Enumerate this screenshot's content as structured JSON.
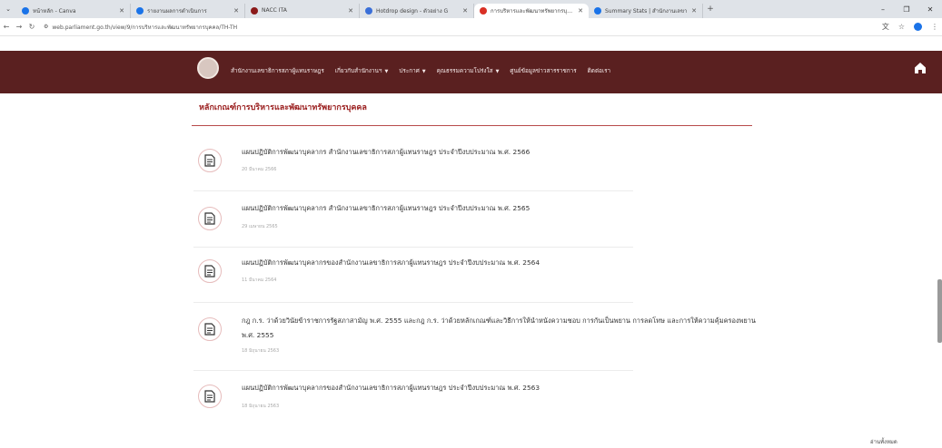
{
  "browser": {
    "tabs": [
      {
        "title": "หน้าหลัก - Canva",
        "favicon_color": "#1a73e8"
      },
      {
        "title": "รายงานผลการดำเนินการ",
        "favicon_color": "#1a73e8"
      },
      {
        "title": "NACC ITA",
        "favicon_color": "#8b1a1a"
      },
      {
        "title": "Hotdrop design - ตัวอย่าง G",
        "favicon_color": "#3a6fd8"
      },
      {
        "title": "การบริหารและพัฒนาทรัพยากรบุคคล",
        "favicon_color": "#d93025"
      },
      {
        "title": "Summary Stats | สำนักงานเลขา",
        "favicon_color": "#1a73e8"
      }
    ],
    "active_tab": 4,
    "url": "web.parliament.go.th/view/9/การบริหารและพัฒนาทรัพยากรบุคคล/TH-TH"
  },
  "site": {
    "nav": [
      {
        "label": "สำนักงานเลขาธิการสภาผู้แทนราษฎร",
        "dropdown": false
      },
      {
        "label": "เกี่ยวกับสำนักงานฯ",
        "dropdown": true
      },
      {
        "label": "ประกาศ",
        "dropdown": true
      },
      {
        "label": "คุณธรรมความโปร่งใส",
        "dropdown": true
      },
      {
        "label": "ศูนย์ข้อมูลข่าวสารราชการ",
        "dropdown": false
      },
      {
        "label": "ติดต่อเรา",
        "dropdown": false
      }
    ]
  },
  "content": {
    "section_title": "หลักเกณฑ์การบริหารและพัฒนาทรัพยากรบุคคล",
    "items": [
      {
        "title": "แผนปฏิบัติการพัฒนาบุคลากร สำนักงานเลขาธิการสภาผู้แทนราษฎร ประจำปีงบประมาณ พ.ศ. 2566",
        "date": "20 มีนาคม 2566"
      },
      {
        "title": "แผนปฏิบัติการพัฒนาบุคลากร สำนักงานเลขาธิการสภาผู้แทนราษฎร ประจำปีงบประมาณ พ.ศ. 2565",
        "date": "29 เมษายน 2565"
      },
      {
        "title": "แผนปฏิบัติการพัฒนาบุคลากรของสำนักงานเลขาธิการสภาผู้แทนราษฎร ประจำปีงบประมาณ พ.ศ. 2564",
        "date": "11 มีนาคม 2564"
      },
      {
        "title": "กฎ ก.ร. ว่าด้วยวินัยข้าราชการรัฐสภาสามัญ พ.ศ. 2555 และกฎ ก.ร. ว่าด้วยหลักเกณฑ์และวิธีการให้นำหนังความชอบ การกันเป็นพยาน การลดโทษ และการให้ความคุ้มครองพยาน พ.ศ. 2555",
        "date": "18 มิถุนายน 2563"
      },
      {
        "title": "แผนปฏิบัติการพัฒนาบุคลากรของสำนักงานเลขาธิการสภาผู้แทนราษฎร ประจำปีงบประมาณ พ.ศ. 2563",
        "date": "18 มิถุนายน 2563"
      }
    ],
    "more_label": "อ่านทั้งหมด"
  },
  "colors": {
    "header_bg": "#5a2020",
    "accent": "#9a1e1e"
  }
}
